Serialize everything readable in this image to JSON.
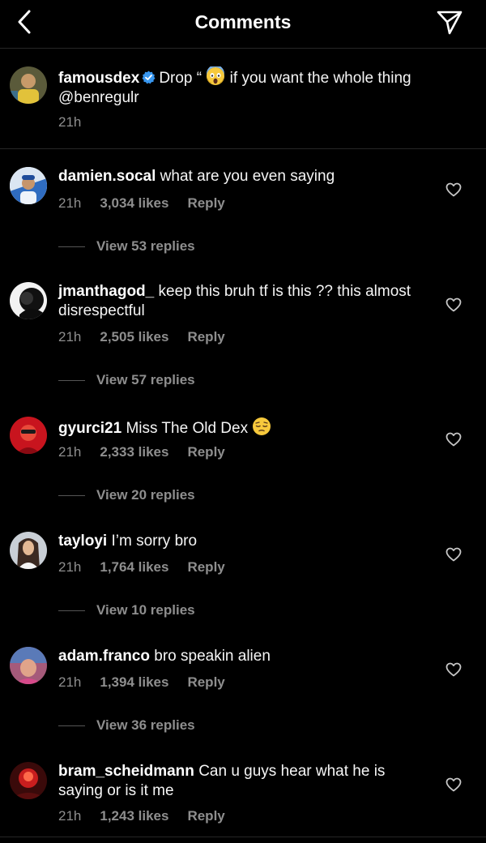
{
  "header": {
    "title": "Comments"
  },
  "caption": {
    "username": "famousdex",
    "text_before_emoji": "Drop “",
    "text_after_emoji": " if you want the whole thing @benregulr",
    "time": "21h",
    "avatar_color": "#6b6a3a"
  },
  "comments": [
    {
      "username": "damien.socal",
      "text": "what are you even saying",
      "time": "21h",
      "likes": "3,034 likes",
      "reply": "Reply",
      "view_replies": "View 53 replies",
      "avatar_color": "#3a6fb5"
    },
    {
      "username": "jmanthagod_",
      "text": "keep this bruh tf is this ?? this almost disrespectful",
      "time": "21h",
      "likes": "2,505 likes",
      "reply": "Reply",
      "view_replies": "View 57 replies",
      "avatar_color": "#e8e8e8"
    },
    {
      "username": "gyurci21",
      "text": "Miss The Old Dex",
      "time": "21h",
      "likes": "2,333 likes",
      "reply": "Reply",
      "view_replies": "View 20 replies",
      "avatar_color": "#c8141e"
    },
    {
      "username": "tayloyi",
      "text": "I’m sorry bro",
      "time": "21h",
      "likes": "1,764 likes",
      "reply": "Reply",
      "view_replies": "View 10 replies",
      "avatar_color": "#c9cfd6"
    },
    {
      "username": "adam.franco",
      "text": "bro speakin alien",
      "time": "21h",
      "likes": "1,394 likes",
      "reply": "Reply",
      "view_replies": "View 36 replies",
      "avatar_color": "#a55a7a"
    },
    {
      "username": "bram_scheidmann",
      "text": "Can u guys hear what he is saying or is it me",
      "time": "21h",
      "likes": "1,243 likes",
      "reply": "Reply",
      "avatar_color": "#7a1a1a"
    }
  ],
  "icons": {
    "back": "chevron-left-icon",
    "send": "paper-plane-icon",
    "verified": "verified-badge-icon",
    "like": "heart-outline-icon"
  },
  "colors": {
    "background": "#000000",
    "secondary_text": "#8e8e8e",
    "verified": "#3897f0"
  }
}
